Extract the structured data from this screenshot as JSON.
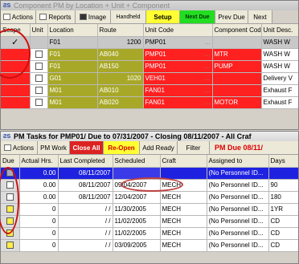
{
  "window1": {
    "title": "Component PM by Location + Unit + Component",
    "toolbar": {
      "actions": "Actions",
      "reports": "Reports",
      "image": "Image",
      "handheld": "Handheld",
      "setup": "Setup",
      "next_due": "Next Due",
      "prev_due": "Prev Due",
      "next": "Next"
    },
    "columns": [
      "Scope",
      "Unit",
      "Location",
      "Route",
      "Unit Code",
      "Component Code",
      "Unit Desc."
    ],
    "rows": [
      {
        "check": "✓",
        "location": "F01",
        "route": "1200",
        "unit_code": "PMP01",
        "component": "",
        "desc": "WASH W"
      },
      {
        "check": "",
        "location": "F01",
        "route": "AB040",
        "unit_code": "PMP01",
        "component": "MTR",
        "desc": "WASH W"
      },
      {
        "check": "",
        "location": "F01",
        "route": "AB150",
        "unit_code": "PMP01",
        "component": "PUMP",
        "desc": "WASH W"
      },
      {
        "check": "",
        "location": "G01",
        "route": "1020",
        "unit_code": "VEH01",
        "component": "",
        "desc": "Delivery V"
      },
      {
        "check": "",
        "location": "M01",
        "route": "AB010",
        "unit_code": "FAN01",
        "component": "",
        "desc": "Exhaust F"
      },
      {
        "check": "",
        "location": "M01",
        "route": "AB020",
        "unit_code": "FAN01",
        "component": "MOTOR",
        "desc": "Exhaust F"
      }
    ]
  },
  "window2": {
    "title": "PM Tasks for PMP01/        Due  to 07/31/2007 - Closing 08/11/2007 - All Craf",
    "toolbar": {
      "actions": "Actions",
      "pm_work": "PM Work",
      "close_all": "Close All",
      "reopen": "Re-Open",
      "add_ready": "Add Ready",
      "filter": "Filter",
      "pm_due": "PM Due 08/11/"
    },
    "columns": [
      "Due",
      "Actual Hrs.",
      "Last Completed",
      "Scheduled",
      "Craft",
      "Assigned to",
      "Days"
    ],
    "rows": [
      {
        "actual": "0.00",
        "last": "08/11/2007",
        "scheduled": "",
        "craft": "",
        "assigned": "(No Personnel ID...",
        "days": ""
      },
      {
        "actual": "0.00",
        "last": "08/11/2007",
        "scheduled": "09/04/2007",
        "craft": "MECH",
        "assigned": "(No Personnel ID...",
        "days": "90"
      },
      {
        "actual": "0.00",
        "last": "08/11/2007",
        "scheduled": "12/04/2007",
        "craft": "MECH",
        "assigned": "(No Personnel ID...",
        "days": "180"
      },
      {
        "actual": "0",
        "last": "/ /",
        "scheduled": "11/30/2005",
        "craft": "MECH",
        "assigned": "(No Personnel ID...",
        "days": "1YR"
      },
      {
        "actual": "0",
        "last": "/ /",
        "scheduled": "11/02/2005",
        "craft": "MECH",
        "assigned": "(No Personnel ID...",
        "days": "CD"
      },
      {
        "actual": "0",
        "last": "/ /",
        "scheduled": "11/02/2005",
        "craft": "MECH",
        "assigned": "(No Personnel ID...",
        "days": "CD"
      },
      {
        "actual": "0",
        "last": "/ /",
        "scheduled": "03/09/2005",
        "craft": "MECH",
        "assigned": "(No Personnel ID...",
        "days": "CD"
      }
    ]
  }
}
